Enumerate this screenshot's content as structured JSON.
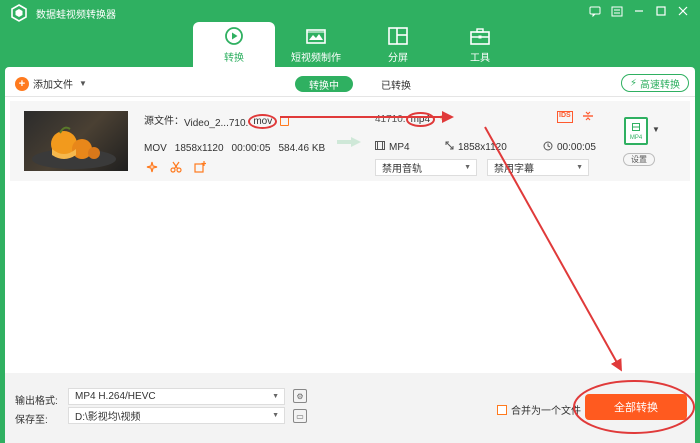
{
  "app": {
    "title": "数据蛙视频转换器"
  },
  "window_controls": [
    "message-icon",
    "menu-icon",
    "minimize-icon",
    "maximize-icon",
    "close-icon"
  ],
  "nav": {
    "tabs": [
      {
        "label": "转换",
        "icon": "convert-icon",
        "active": true
      },
      {
        "label": "短视频制作",
        "icon": "short-video-icon",
        "active": false
      },
      {
        "label": "分屏",
        "icon": "split-screen-icon",
        "active": false
      },
      {
        "label": "工具",
        "icon": "toolbox-icon",
        "active": false
      }
    ]
  },
  "toolbar": {
    "add_file": "添加文件",
    "tab_converting": "转换中",
    "tab_converted": "已转换",
    "high_speed": "高速转换"
  },
  "file": {
    "source_label": "源文件：",
    "source_name": "Video_2...710.",
    "source_ext": "mov",
    "format": "MOV",
    "resolution": "1858x1120",
    "duration": "00:00:05",
    "size": "584.46 KB",
    "output_name_tail": "41710.",
    "output_ext": "mp4",
    "output_format": "MP4",
    "output_resolution": "1858x1120",
    "output_duration": "00:00:05",
    "audio_track": "禁用音轨",
    "subtitle": "禁用字幕",
    "format_badge": "MP4",
    "settings": "设置"
  },
  "bottom": {
    "output_format_label": "输出格式:",
    "output_format_value": "MP4 H.264/HEVC",
    "save_to_label": "保存至:",
    "save_to_value": "D:\\影视均\\视频",
    "merge_label": "合并为一个文件",
    "convert_all": "全部转换"
  },
  "colors": {
    "brand_green": "#2fb061",
    "accent_orange": "#ff5a1f",
    "annotation_red": "#e03a3a"
  }
}
